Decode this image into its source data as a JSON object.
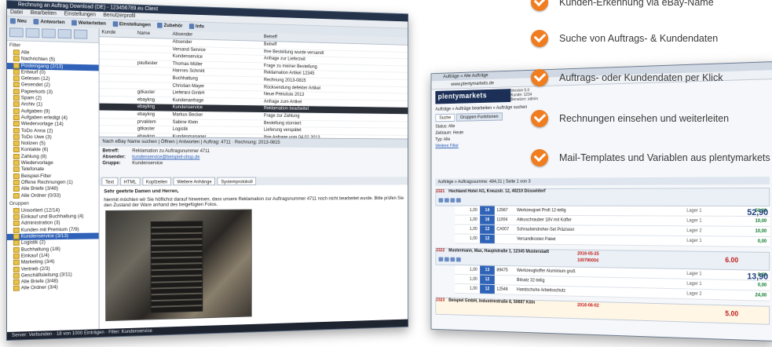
{
  "left_window": {
    "title": "Rechnung an Auftrag Download (DE) - 123456789.eu Client",
    "menu": [
      "Datei",
      "Bearbeiten",
      "Einstellungen",
      "Benutzerprofil"
    ],
    "toolbar": [
      "Neu",
      "Antworten",
      "Weiterleiten",
      "Einstellungen",
      "Zubehör",
      "Info"
    ],
    "sidebar": {
      "filter_title": "Filter",
      "folders": [
        {
          "label": "Alle"
        },
        {
          "label": "Nachrichten (5)"
        },
        {
          "label": "Posteingang (2/13)",
          "selected": true
        },
        {
          "label": "Entwurf (0)"
        },
        {
          "label": "Gelesen (12)"
        },
        {
          "label": "Gesendet (2)"
        },
        {
          "label": "Papierkorb (3)"
        },
        {
          "label": "Spam (2)"
        },
        {
          "label": "Archiv (1)"
        },
        {
          "label": "Aufgaben (9)"
        },
        {
          "label": "Aufgaben erledigt (4)"
        },
        {
          "label": "Wiedervorlage (14)"
        },
        {
          "label": "ToDo Anna (2)"
        },
        {
          "label": "ToDo Uwe (3)"
        },
        {
          "label": "Notizen (5)"
        },
        {
          "label": "Kontakte (6)"
        },
        {
          "label": "Zahlung (8)"
        },
        {
          "label": "Wiedervorlage"
        },
        {
          "label": "Telefonate"
        },
        {
          "label": "Beispiel-Filter"
        },
        {
          "label": "Offene Rechnungen (1)"
        },
        {
          "label": "Alle Briefe (3/48)"
        },
        {
          "label": "Alle Ordner (0/33)"
        }
      ],
      "groups_title": "Gruppen",
      "groups": [
        {
          "label": "Unsortiert (12/14)"
        },
        {
          "label": "Einkauf und Buchhaltung (4)"
        },
        {
          "label": "Administration (3)"
        },
        {
          "label": "Kunden mit Premium (7/9)"
        },
        {
          "label": "Kundenservice (3/13)",
          "selected": true
        },
        {
          "label": "Logistik (2)"
        },
        {
          "label": "Buchhaltung (1/8)"
        },
        {
          "label": "Einkauf (1/4)"
        },
        {
          "label": "Marketing (3/4)"
        },
        {
          "label": "Vertrieb (2/3)"
        },
        {
          "label": "Geschäftsleitung (3/11)"
        },
        {
          "label": "Alle Briefe (3/48)"
        },
        {
          "label": "Alle Ordner (3/4)"
        }
      ]
    },
    "list": {
      "columns": [
        "Kunde",
        "Name",
        "Absender",
        "Betreff"
      ],
      "rows": [
        {
          "a": "",
          "b": "",
          "c": "Absender",
          "d": "Betreff"
        },
        {
          "a": "",
          "b": "",
          "c": "Versand Service",
          "d": "Ihre Bestellung wurde versandt"
        },
        {
          "a": "",
          "b": "",
          "c": "Kundenservice",
          "d": "Anfrage zur Lieferzeit"
        },
        {
          "a": "",
          "b": "paultester",
          "c": "Thomas Müller",
          "d": "Frage zu meiner Bestellung"
        },
        {
          "a": "",
          "b": "",
          "c": "Hannes Schmitt",
          "d": "Reklamation Artikel 12345"
        },
        {
          "a": "",
          "b": "",
          "c": "Buchhaltung",
          "d": "Rechnung 2013-0815"
        },
        {
          "a": "",
          "b": "",
          "c": "Christian Mayer",
          "d": "Rücksendung defekter Artikel"
        },
        {
          "a": "",
          "b": "gitkaster",
          "c": "Lieferant GmbH",
          "d": "Neue Preisliste 2013"
        },
        {
          "a": "",
          "b": "ebaykng",
          "c": "Kundenanfrage",
          "d": "Anfrage zum Artikel"
        },
        {
          "a": "",
          "b": "ebaykng",
          "c": "Kundenservice",
          "d": "Reklamation bearbeitet",
          "sel": true
        },
        {
          "a": "",
          "b": "ebaykng",
          "c": "Markus Becker",
          "d": "Frage zur Zahlung"
        },
        {
          "a": "",
          "b": "prvaklem",
          "c": "Sabine Klein",
          "d": "Bestellung storniert"
        },
        {
          "a": "",
          "b": "gitkaster",
          "c": "Logistik",
          "d": "Lieferung verspätet"
        },
        {
          "a": "",
          "b": "ebaykng",
          "c": "Kundenmanager",
          "d": "Ihre Anfrage vom 04.02.2013"
        },
        {
          "a": "",
          "b": "ebaykng",
          "c": "Einkauf",
          "d": "Bestellung bestätigt"
        },
        {
          "a": "",
          "b": "gitkaster",
          "c": "Kundenservice",
          "d": "Rückfrage zum Auftrag"
        }
      ]
    },
    "message_bar": "Nach eBay Name suchen   |   Öffnen   |   Antworten   |   Auftrag: 4711 · Rechnung: 2013-0815",
    "message_header": {
      "betreff_label": "Betreff:",
      "betreff": "Reklamation zu Auftragsnummer 4711",
      "absender_label": "Absender:",
      "absender": "kundenservice@beispiel-shop.de",
      "gruppe_label": "Gruppe:",
      "gruppe": "Kundenservice"
    },
    "tabs": [
      "Text",
      "HTML",
      "Kopfzeilen",
      "Weitere Anhänge",
      "Systemprotokoll"
    ],
    "body": {
      "greeting": "Sehr geehrte Damen und Herren,",
      "text": "hiermit möchten wir Sie höflichst darauf hinweisen, dass unsere Reklamation zur Auftragsnummer 4711 noch nicht bearbeitet wurde. Bitte prüfen Sie den Zustand der Ware anhand des beigefügten Fotos."
    },
    "status": "Server: Verbunden · 18 von 1000 Einträgen · Filter: Kundenservice"
  },
  "right_window": {
    "tab_title": "Aufträge » Alle Aufträge",
    "url": "www.plentymarkets.de",
    "logo": "plentymarkets",
    "logo_sub": [
      "Version 5.0",
      "Kunde: 1234",
      "Benutzer: admin"
    ],
    "breadcrumb": "Aufträge » Aufträge bearbeiten » Aufträge suchen",
    "nav_tabs": [
      "Suche",
      "Gruppen-Funktionen"
    ],
    "filter_lines": [
      "Status: Alle",
      "Zeitraum: Heute",
      "Typ: Alle",
      "Weitere Filter"
    ],
    "order_bar": "Aufträge » Auftragssumme: 484,31 | Seite 1 von 3",
    "orders": [
      {
        "id": "2321",
        "name": "Hochland Hotel AG, Kreuzstr. 12, 40210 Düsseldorf",
        "items": [
          {
            "qty": "1,00",
            "badge": "14",
            "id": "12567",
            "desc": "Werkzeugset Profi 12-teilig",
            "wh": "Lager 1",
            "price": "50,00"
          },
          {
            "qty": "1,00",
            "badge": "16",
            "id": "11004",
            "desc": "Akkuschrauber 18V mit Koffer",
            "wh": "Lager 1",
            "price": "10,00"
          },
          {
            "qty": "1,00",
            "badge": "12",
            "id": "CA007",
            "desc": "Schraubendreher-Set Präzision",
            "wh": "Lager 2",
            "price": "10,00"
          },
          {
            "qty": "1,00",
            "badge": "12",
            "id": "",
            "desc": "Versandkosten Paket",
            "wh": "Lager 1",
            "price": "0,00"
          }
        ],
        "total": "52,90"
      },
      {
        "id": "2322",
        "name": "Mustermann, Max, Hauptstraße 1, 12345 Musterstadt",
        "date": "2016-05-25",
        "order_no": "100790004",
        "price_red": "6.00",
        "items": [
          {
            "qty": "1,00",
            "badge": "13",
            "id": "89475",
            "desc": "Werkzeugkoffer Aluminium groß",
            "wh": "Lager 1",
            "price": "8,00"
          },
          {
            "qty": "1,00",
            "badge": "12",
            "id": "",
            "desc": "Bitsatz 32-teilig",
            "wh": "Lager 1",
            "price": "0,00"
          },
          {
            "qty": "1,00",
            "badge": "12",
            "id": "12548",
            "desc": "Handschuhe Arbeitsschutz",
            "wh": "Lager 2",
            "price": "24,00"
          }
        ],
        "total": "13,90"
      }
    ],
    "footer_order": {
      "id": "2323",
      "name": "Beispiel GmbH, Industriestraße 8, 50667 Köln",
      "date": "2016-06-02",
      "price_red": "5.00"
    }
  },
  "features": [
    "Kunden-Erkennung via eBay-Name",
    "Suche von Auftrags- & Kundendaten",
    "Auftrags- oder Kundendaten per Klick",
    "Rechnungen einsehen und weiterleiten",
    "Mail-Templates und Variablen aus plentymarkets"
  ],
  "colors": {
    "accent": "#f07d1f",
    "brand": "#1b2f57",
    "selection": "#2f62b8"
  }
}
